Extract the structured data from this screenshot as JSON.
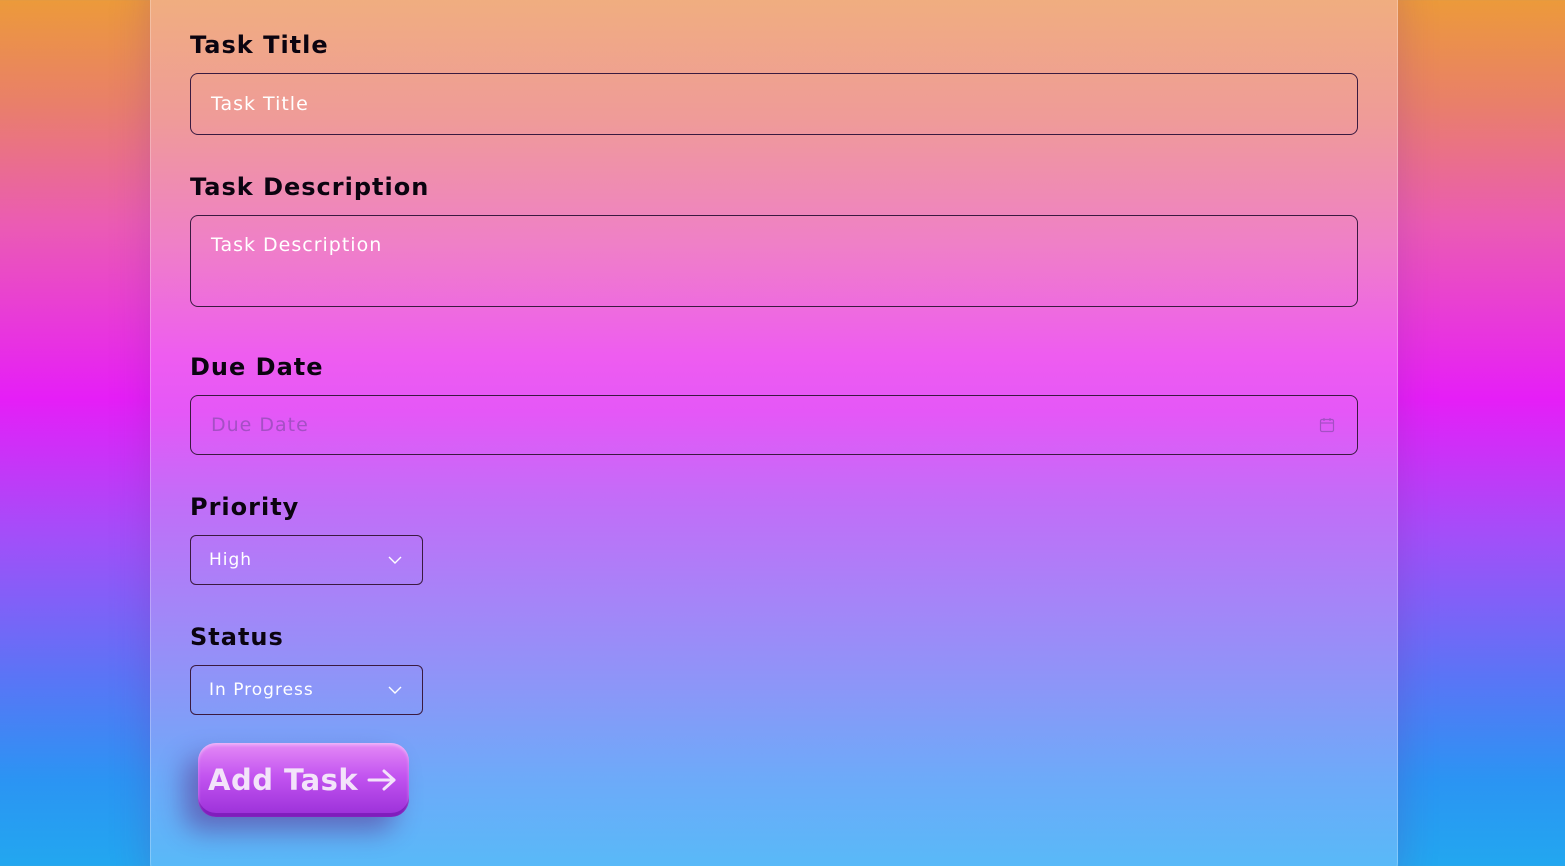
{
  "form": {
    "title_label": "Task Title",
    "title_placeholder": "Task Title",
    "description_label": "Task Description",
    "description_placeholder": "Task Description",
    "due_date_label": "Due Date",
    "due_date_placeholder": "Due Date",
    "priority_label": "Priority",
    "priority_value": "High",
    "status_label": "Status",
    "status_value": "In Progress",
    "submit_label": "Add Task"
  },
  "icons": {
    "date": "calendar-icon",
    "dropdown": "chevron-down-icon",
    "submit": "arrow-right-icon"
  },
  "colors": {
    "label_text": "#0b0410",
    "field_border": "#3a1a40",
    "button_top": "#e58af5",
    "button_bottom": "#9a2fd8"
  }
}
